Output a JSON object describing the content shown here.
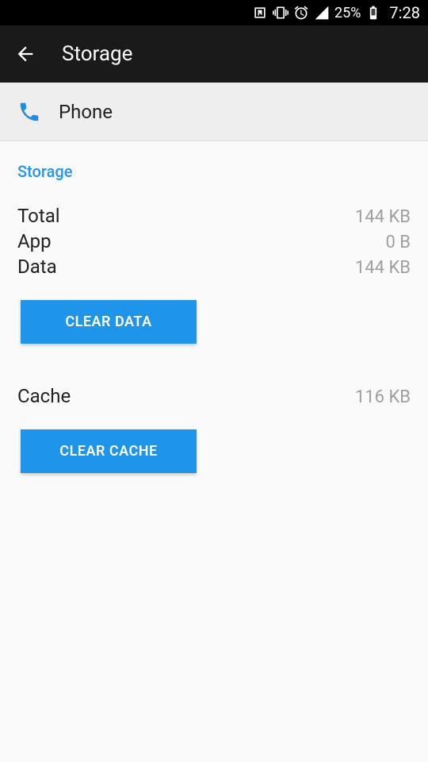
{
  "status_bar": {
    "battery_pct": "25%",
    "time": "7:28"
  },
  "app_bar": {
    "title": "Storage"
  },
  "app_row": {
    "name": "Phone"
  },
  "section": {
    "title": "Storage"
  },
  "rows": {
    "total_label": "Total",
    "total_value": "144 KB",
    "app_label": "App",
    "app_value": "0 B",
    "data_label": "Data",
    "data_value": "144 KB",
    "cache_label": "Cache",
    "cache_value": "116 KB"
  },
  "buttons": {
    "clear_data": "CLEAR DATA",
    "clear_cache": "CLEAR CACHE"
  }
}
